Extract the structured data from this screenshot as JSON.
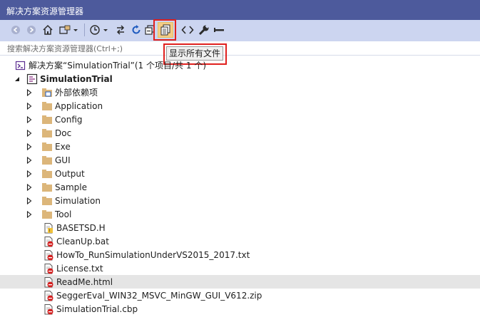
{
  "window": {
    "title": "解决方案资源管理器"
  },
  "toolbar": {
    "buttons": [
      {
        "name": "back",
        "icon": "back-arrow-icon"
      },
      {
        "name": "forward",
        "icon": "forward-arrow-icon"
      },
      {
        "name": "home",
        "icon": "home-icon"
      },
      {
        "name": "switch-views",
        "icon": "switch-views-icon"
      },
      {
        "name": "pending-changes",
        "icon": "clock-icon"
      },
      {
        "name": "sync",
        "icon": "sync-icon"
      },
      {
        "name": "refresh",
        "icon": "refresh-icon"
      },
      {
        "name": "collapse-all",
        "icon": "collapse-icon"
      },
      {
        "name": "show-all-files",
        "icon": "show-all-files-icon"
      },
      {
        "name": "view-code",
        "icon": "code-icon"
      },
      {
        "name": "properties",
        "icon": "wrench-icon"
      },
      {
        "name": "preview",
        "icon": "minus-icon"
      }
    ]
  },
  "tooltip": {
    "text": "显示所有文件"
  },
  "search": {
    "placeholder": "搜索解决方案资源管理器(Ctrl+;)"
  },
  "tree": {
    "solution": "解决方案“SimulationTrial”(1 个项目/共 1 个)",
    "project": "SimulationTrial",
    "external_deps": "外部依赖项",
    "folders": [
      "Application",
      "Config",
      "Doc",
      "Exe",
      "GUI",
      "Output",
      "Sample",
      "Simulation",
      "Tool"
    ],
    "files": [
      "BASETSD.H",
      "CleanUp.bat",
      "HowTo_RunSimulationUnderVS2015_2017.txt",
      "License.txt",
      "ReadMe.html",
      "SeggerEval_WIN32_MSVC_MinGW_GUI_V612.zip",
      "SimulationTrial.cbp"
    ],
    "selected_file": "ReadMe.html"
  },
  "colors": {
    "title_bar": "#4d5a9c",
    "toolbar": "#ccd5f0",
    "highlight": "#e0201e",
    "folder": "#dcb67a",
    "selected_row": "#e5e5e5"
  }
}
